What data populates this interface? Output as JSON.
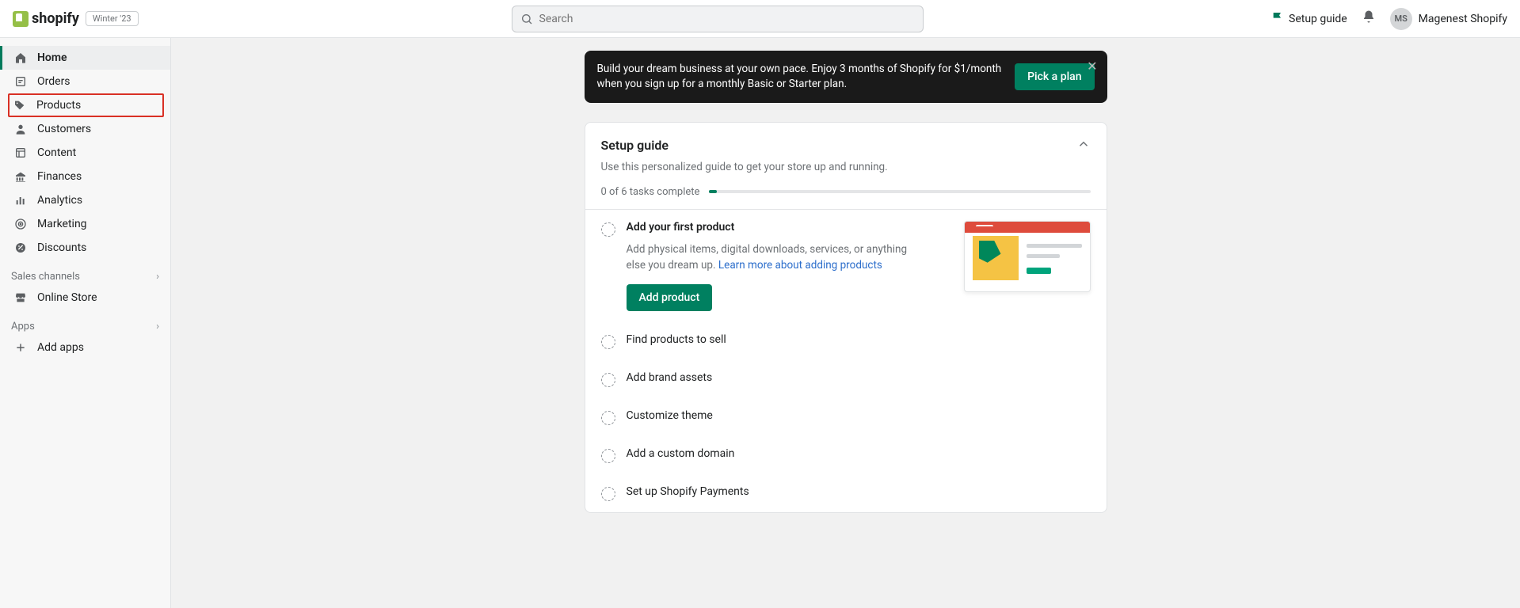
{
  "brand": "shopify",
  "badge": "Winter '23",
  "search_placeholder": "Search",
  "header": {
    "setup_guide": "Setup guide",
    "avatar_initials": "MS",
    "username": "Magenest Shopify"
  },
  "nav": {
    "home": "Home",
    "orders": "Orders",
    "products": "Products",
    "customers": "Customers",
    "content": "Content",
    "finances": "Finances",
    "analytics": "Analytics",
    "marketing": "Marketing",
    "discounts": "Discounts",
    "sales_channels": "Sales channels",
    "online_store": "Online Store",
    "apps": "Apps",
    "add_apps": "Add apps"
  },
  "banner": {
    "text": "Build your dream business at your own pace. Enjoy 3 months of Shopify for $1/month when you sign up for a monthly Basic or Starter plan.",
    "cta": "Pick a plan"
  },
  "guide": {
    "title": "Setup guide",
    "subtitle": "Use this personalized guide to get your store up and running.",
    "progress_text": "0 of 6 tasks complete",
    "tasks": {
      "t1": {
        "title": "Add your first product",
        "desc_pre": "Add physical items, digital downloads, services, or anything else you dream up. ",
        "link": "Learn more about adding products",
        "cta": "Add product"
      },
      "t2": "Find products to sell",
      "t3": "Add brand assets",
      "t4": "Customize theme",
      "t5": "Add a custom domain",
      "t6": "Set up Shopify Payments"
    }
  }
}
